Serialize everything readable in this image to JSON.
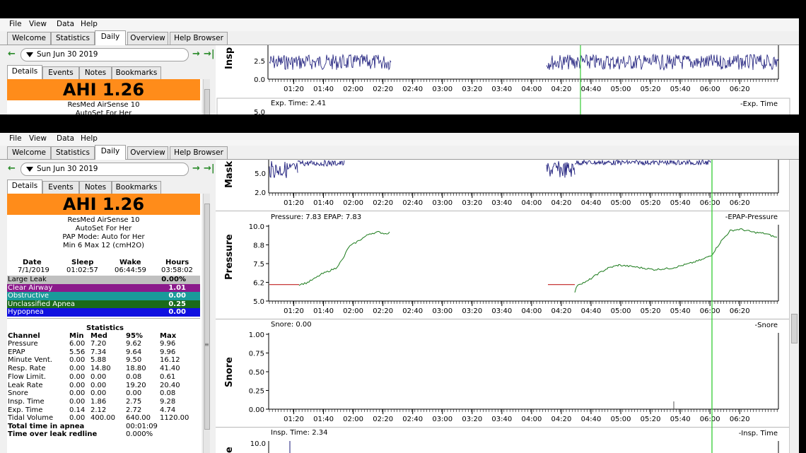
{
  "menu": [
    "File",
    "View",
    "Data",
    "Help"
  ],
  "main_tabs": [
    "Welcome",
    "Statistics",
    "Daily",
    "Overview",
    "Help Browser"
  ],
  "active_main_tab": "Daily",
  "date_label": "Sun Jun 30 2019",
  "sub_tabs": [
    "Details",
    "Events",
    "Notes",
    "Bookmarks"
  ],
  "ahi_label": "AHI 1.26",
  "device": {
    "name": "ResMed AirSense 10",
    "model": "AutoSet For Her",
    "mode": "PAP Mode: Auto for Her",
    "range": "Min 6 Max 12 (cmH2O)"
  },
  "session": {
    "headers": [
      "Date",
      "Sleep",
      "Wake",
      "Hours"
    ],
    "values": [
      "7/1/2019",
      "01:02:57",
      "06:44:59",
      "03:58:02"
    ]
  },
  "events": [
    {
      "name": "Large Leak",
      "value": "0.00%",
      "color": "#c0c0c0",
      "text_color": "#000000"
    },
    {
      "name": "Clear Airway",
      "value": "1.01",
      "color": "#8b1a8b",
      "text_color": "#ffffff"
    },
    {
      "name": "Obstructive",
      "value": "0.00",
      "color": "#1a9a9a",
      "text_color": "#ffffff"
    },
    {
      "name": "Unclassified Apnea",
      "value": "0.25",
      "color": "#1a6a1a",
      "text_color": "#ffffff"
    },
    {
      "name": "Hypopnea",
      "value": "0.00",
      "color": "#1010e0",
      "text_color": "#ffffff"
    }
  ],
  "statistics": {
    "title": "Statistics",
    "headers": [
      "Channel",
      "Min",
      "Med",
      "95%",
      "Max"
    ],
    "rows": [
      [
        "Pressure",
        "6.00",
        "7.20",
        "9.62",
        "9.96"
      ],
      [
        "EPAP",
        "5.56",
        "7.34",
        "9.64",
        "9.96"
      ],
      [
        "Minute Vent.",
        "0.00",
        "5.88",
        "9.50",
        "16.12"
      ],
      [
        "Resp. Rate",
        "0.00",
        "14.80",
        "18.80",
        "41.40"
      ],
      [
        "Flow Limit.",
        "0.00",
        "0.00",
        "0.08",
        "0.61"
      ],
      [
        "Leak Rate",
        "0.00",
        "0.00",
        "19.20",
        "20.40"
      ],
      [
        "Snore",
        "0.00",
        "0.00",
        "0.00",
        "0.08"
      ],
      [
        "Insp. Time",
        "0.00",
        "1.86",
        "2.75",
        "9.28"
      ],
      [
        "Exp. Time",
        "0.14",
        "2.12",
        "2.72",
        "4.74"
      ],
      [
        "Tidal Volume",
        "0.00",
        "400.00",
        "640.00",
        "1120.00"
      ]
    ]
  },
  "totals": [
    {
      "label": "Total time in apnea",
      "value": "00:01:09"
    },
    {
      "label": "Time over leak redline",
      "value": "0.000%"
    }
  ],
  "time_ticks": [
    "01:20",
    "01:40",
    "02:00",
    "02:20",
    "02:40",
    "03:00",
    "03:20",
    "03:40",
    "04:00",
    "04:20",
    "04:40",
    "05:00",
    "05:20",
    "05:40",
    "06:00",
    "06:20"
  ],
  "graphs_top": {
    "insp_label": "Insp",
    "insp_ticks": [
      "2.5",
      "0.0"
    ],
    "exp_title": "Exp. Time: 2.41",
    "exp_legend": "-Exp. Time",
    "exp_top_tick": "5.0"
  },
  "graphs": {
    "mask": {
      "ylabel": "Mask I",
      "ticks": [
        "5.0",
        "2.0"
      ]
    },
    "pressure": {
      "title": "Pressure: 7.83 EPAP: 7.83",
      "legend": "-EPAP-Pressure",
      "ylabel": "Pressure",
      "ticks": [
        "10.0",
        "8.8",
        "7.5",
        "6.2",
        "5.0"
      ],
      "pressure_color": "#1a7a1a",
      "epap_color": "#c02020"
    },
    "snore": {
      "title": "Snore: 0.00",
      "legend": "-Snore",
      "ylabel": "Snore",
      "ticks": [
        "1.00",
        "0.75",
        "0.50",
        "0.25",
        "0.00"
      ]
    },
    "insp": {
      "title": "Insp. Time: 2.34",
      "legend": "-Insp. Time",
      "top_tick": "10.0"
    }
  },
  "colors": {
    "marker": "#33cc33",
    "flow": "#1a1a7a",
    "ahi_bg": "#ff8c1a"
  }
}
